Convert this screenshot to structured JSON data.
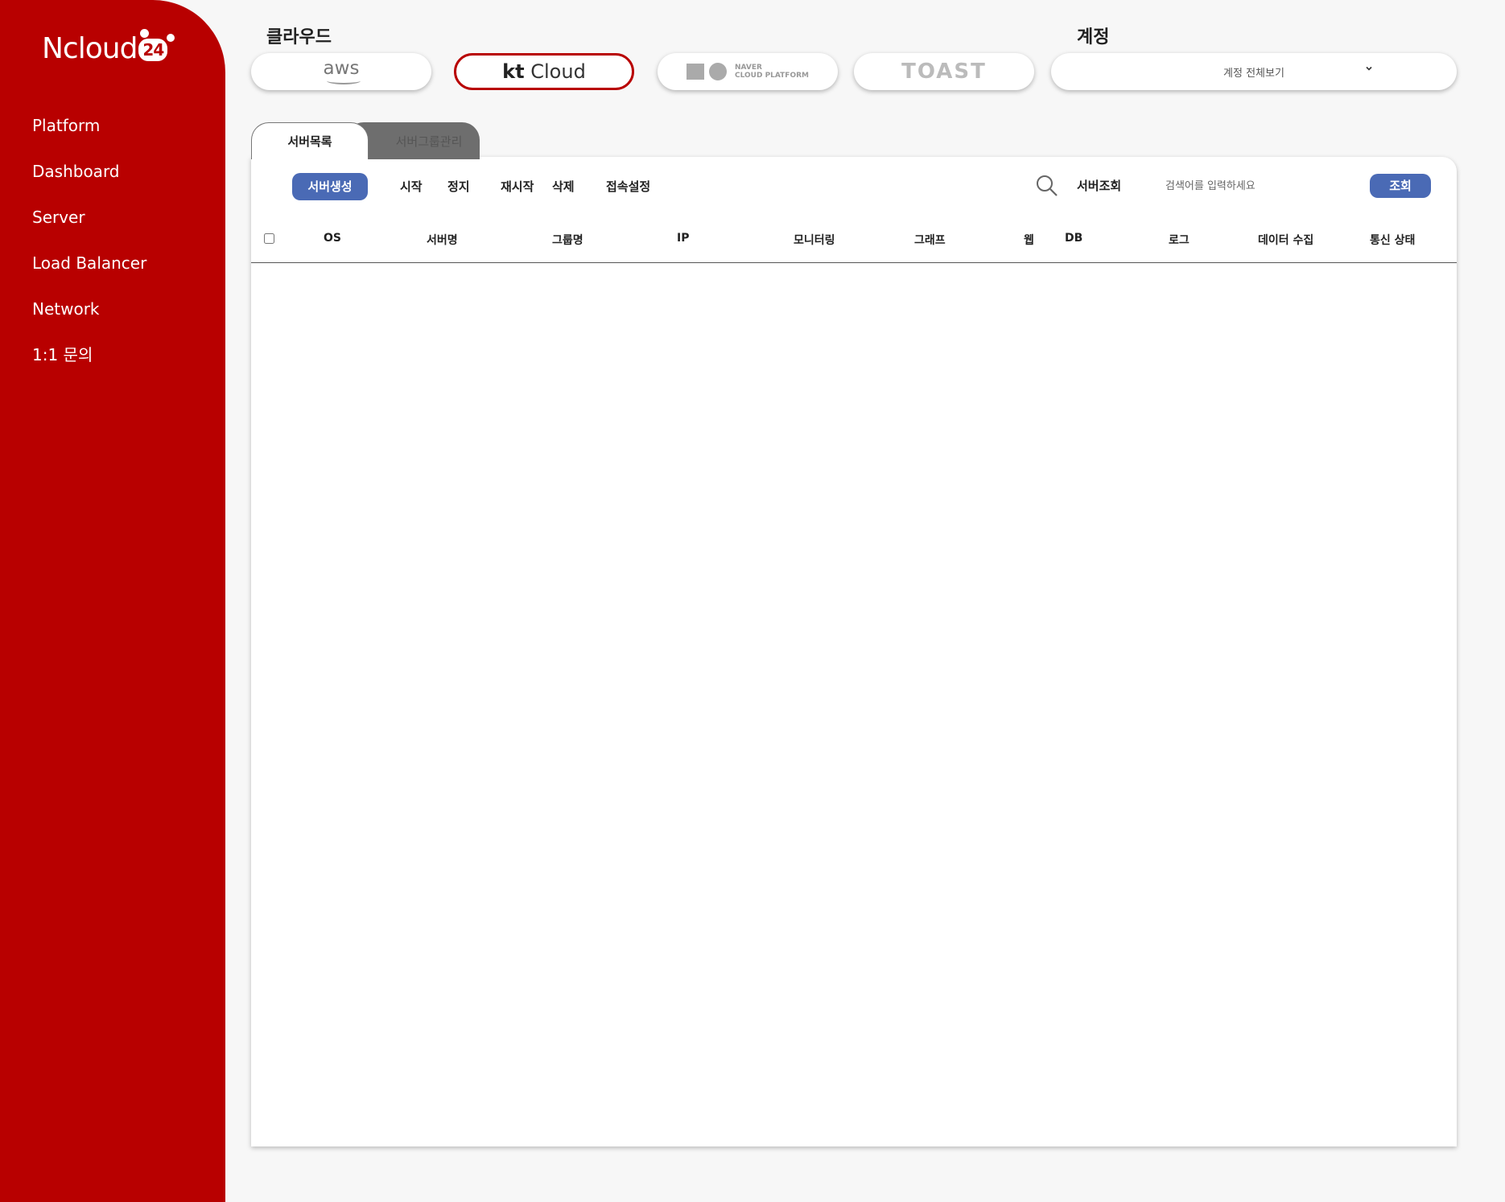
{
  "sidebar": {
    "logo_text": "Ncloud",
    "logo_badge": "24",
    "nav": [
      "Platform",
      "Dashboard",
      "Server",
      "Load Balancer",
      "Network",
      "1:1 문의"
    ]
  },
  "top": {
    "cloud_label": "클라우드",
    "account_label": "계정",
    "clouds": {
      "aws": "aws",
      "kt_prefix": "kt",
      "kt_suffix": "Cloud",
      "naver_line1": "NAVER",
      "naver_line2": "CLOUD PLATFORM",
      "toast": "TOAST"
    },
    "active_cloud": "kt Cloud",
    "account_select_value": "계정 전체보기"
  },
  "tabs": [
    "서버목록",
    "서버그룹관리"
  ],
  "toolbar": {
    "create": "서버생성",
    "start": "시작",
    "stop": "정지",
    "restart": "재시작",
    "delete": "삭제",
    "connect_settings": "접속설정",
    "search_label": "서버조회",
    "search_placeholder": "검색어를 입력하세요",
    "query": "조회"
  },
  "table": {
    "columns": [
      "OS",
      "서버명",
      "그룹명",
      "IP",
      "모니터링",
      "그래프",
      "웹",
      "DB",
      "로그",
      "데이터 수집",
      "통신 상태"
    ],
    "rows": []
  },
  "colors": {
    "brand": "#b80000",
    "accent_button": "#4a6ab5"
  }
}
